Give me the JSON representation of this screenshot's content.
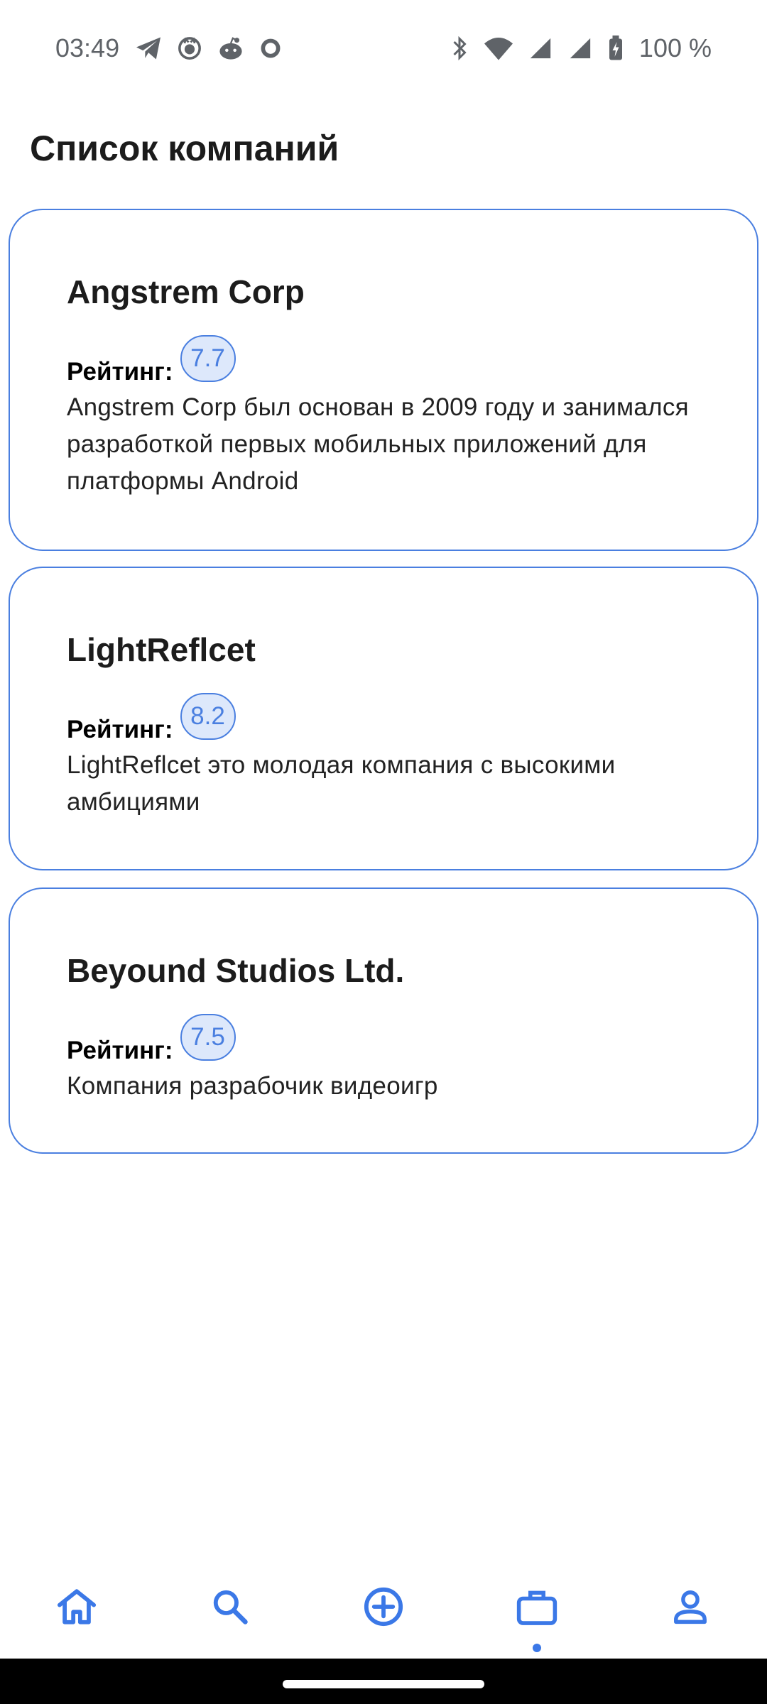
{
  "status_bar": {
    "time": "03:49",
    "battery": "100 %",
    "icons_left": [
      "telegram-icon",
      "github-icon",
      "reddit-icon",
      "circle-icon"
    ],
    "icons_right": [
      "bluetooth-icon",
      "wifi-icon",
      "signal-icon",
      "signal-icon",
      "battery-charging-icon"
    ]
  },
  "page": {
    "title": "Список компаний"
  },
  "companies": [
    {
      "name": "Angstrem Corp",
      "rating_label": "Рейтинг:",
      "rating": "7.7",
      "description": "Angstrem Corp был основан в 2009 году и занимался разработкой первых мобильных приложений для платформы Android"
    },
    {
      "name": "LightReflcet",
      "rating_label": "Рейтинг:",
      "rating": "8.2",
      "description": "LightReflcet это молодая компания с высокими амбициями"
    },
    {
      "name": "Beyound Studios Ltd.",
      "rating_label": "Рейтинг:",
      "rating": "7.5",
      "description": "Компания разрабочик видеоигр"
    }
  ],
  "bottom_nav": {
    "items": [
      "home-icon",
      "search-icon",
      "add-circle-icon",
      "briefcase-icon",
      "person-icon"
    ],
    "active_index": 3
  },
  "colors": {
    "accent": "#4a7fe0",
    "badge_bg": "#dde8fb",
    "text": "#1c1c1c"
  }
}
